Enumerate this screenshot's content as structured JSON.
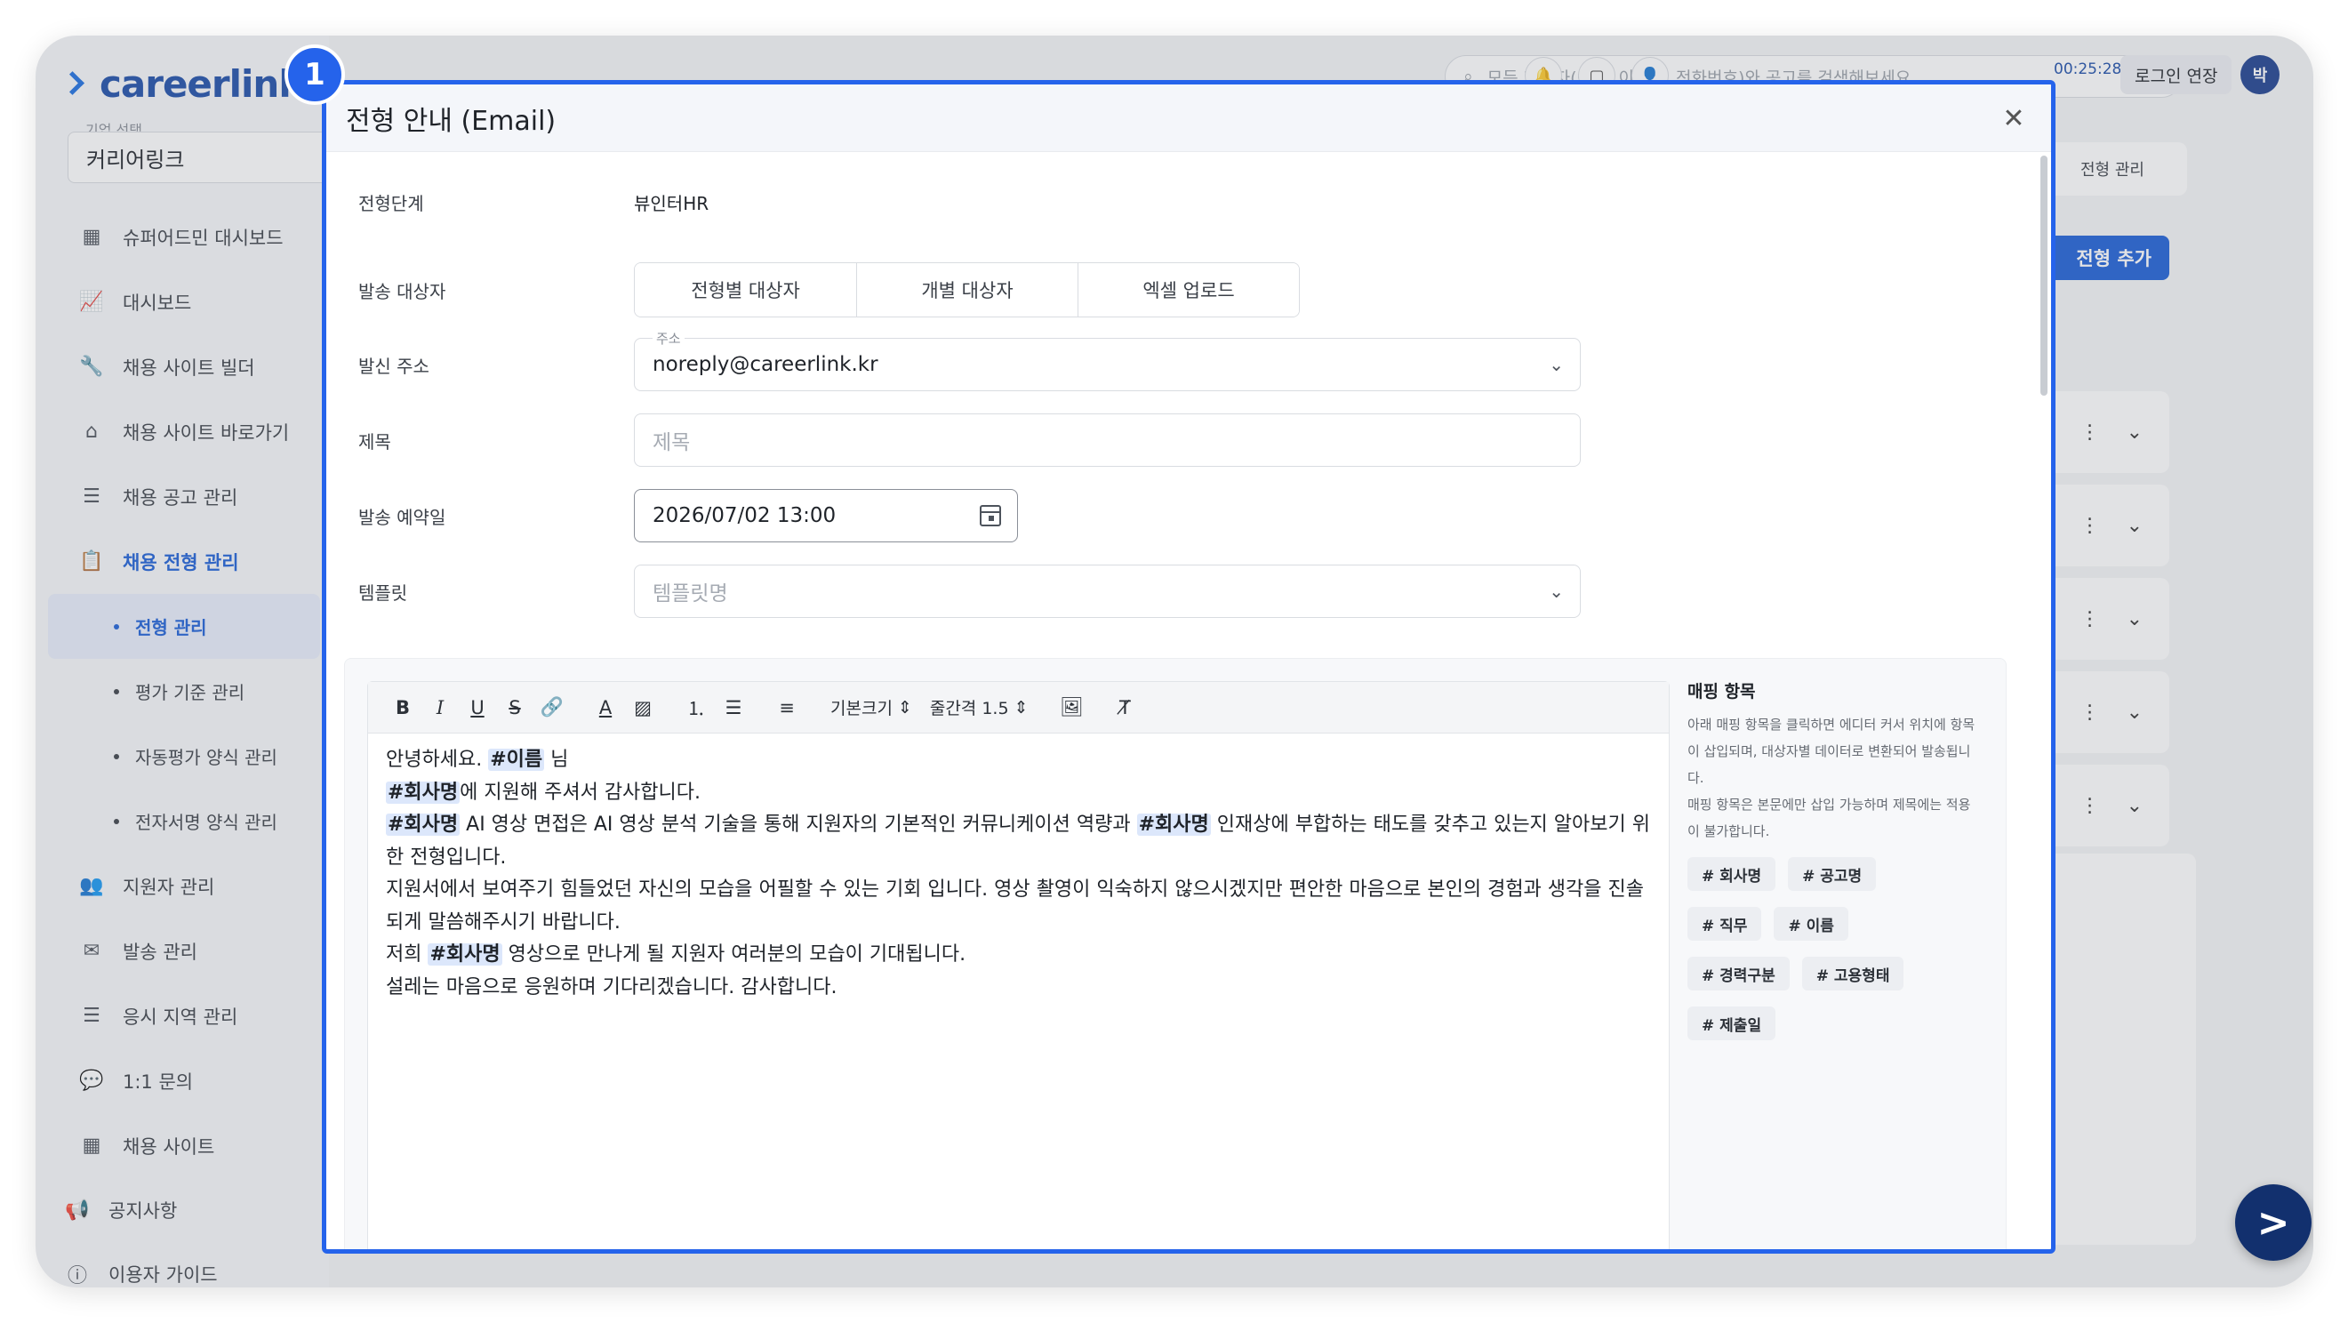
{
  "app": {
    "logo_text": "careerlink",
    "company_label": "기업 선택",
    "company_value": "커리어링크",
    "search_placeholder": "모든 지원자(이름, 이메일, 전화번호)와 공고를 검색해보세요",
    "timer": "00:25:28",
    "extend_login": "로그인 연장",
    "avatar_initial": "박",
    "breadcrumb_tail": "전형 관리",
    "add_stage_label": "전형 추가",
    "step_badge": "1"
  },
  "sidebar": {
    "items": [
      {
        "label": "슈퍼어드민 대시보드",
        "icon": "calendar-icon"
      },
      {
        "label": "대시보드",
        "icon": "chart-icon"
      },
      {
        "label": "채용 사이트 빌더",
        "icon": "wrench-icon"
      },
      {
        "label": "채용 사이트 바로가기",
        "icon": "home-icon"
      },
      {
        "label": "채용 공고 관리",
        "icon": "list-icon"
      },
      {
        "label": "채용 전형 관리",
        "icon": "clipboard-icon",
        "active": true
      }
    ],
    "sub_items": [
      {
        "label": "전형 관리",
        "active": true
      },
      {
        "label": "평가 기준 관리"
      },
      {
        "label": "자동평가 양식 관리"
      },
      {
        "label": "전자서명 양식 관리"
      }
    ],
    "items2": [
      {
        "label": "지원자 관리",
        "icon": "users-icon"
      },
      {
        "label": "발송 관리",
        "icon": "mail-icon"
      },
      {
        "label": "응시 지역 관리",
        "icon": "list-icon"
      },
      {
        "label": "1:1 문의",
        "icon": "chat-icon"
      },
      {
        "label": "채용 사이트",
        "icon": "calendar-icon"
      }
    ],
    "footer": [
      {
        "label": "공지사항",
        "icon": "megaphone-icon"
      },
      {
        "label": "이용자 가이드",
        "icon": "help-icon"
      }
    ]
  },
  "modal": {
    "title": "전형 안내 (Email)",
    "stage_label": "전형단계",
    "stage_value": "뷰인터HR",
    "recipients_label": "발송 대상자",
    "recipient_tabs": [
      "전형별 대상자",
      "개별 대상자",
      "엑셀 업로드"
    ],
    "sender_label": "발신 주소",
    "sender_float": "주소",
    "sender_value": "noreply@careerlink.kr",
    "subject_label": "제목",
    "subject_placeholder": "제목",
    "schedule_label": "발송 예약일",
    "schedule_value": "2026/07/02 13:00",
    "template_label": "템플릿",
    "template_placeholder": "템플릿명"
  },
  "editor": {
    "font_size_label": "기본크기",
    "line_height_label": "줄간격 1.5",
    "lines": [
      [
        {
          "t": "안녕하세요. "
        },
        {
          "t": "#이름",
          "tag": true
        },
        {
          "t": " 님"
        }
      ],
      [
        {
          "t": "#회사명",
          "tag": true
        },
        {
          "t": "에 지원해 주셔서 감사합니다."
        }
      ],
      [
        {
          "t": "#회사명",
          "tag": true
        },
        {
          "t": " AI 영상 면접은 AI 영상 분석 기술을 통해 지원자의 기본적인 커뮤니케이션 역량과 "
        },
        {
          "t": "#회사명",
          "tag": true
        },
        {
          "t": " 인재상에 부합하는 태도를 갖추고 있는지 알아보기 위한 전형입니다."
        }
      ],
      [
        {
          "t": "지원서에서 보여주기 힘들었던 자신의 모습을 어필할 수 있는 기회 입니다. 영상 촬영이 익숙하지 않으시겠지만 편안한 마음으로 본인의 경험과 생각을 진솔되게 말씀해주시기 바랍니다."
        }
      ],
      [
        {
          "t": "저희 "
        },
        {
          "t": "#회사명",
          "tag": true
        },
        {
          "t": " 영상으로 만나게 될 지원자 여러분의 모습이 기대됩니다."
        }
      ],
      [
        {
          "t": "설레는 마음으로 응원하며 기다리겠습니다. 감사합니다."
        }
      ]
    ]
  },
  "mapping": {
    "title": "매핑 항목",
    "desc1": "아래 매핑 항목을 클릭하면 에디터 커서 위치에 항목이 삽입되며, 대상자별 데이터로 변환되어 발송됩니다.",
    "desc2": "매핑 항목은 본문에만 삽입 가능하며 제목에는 적용이 불가합니다.",
    "chips": [
      "# 회사명",
      "# 공고명",
      "# 직무",
      "# 이름",
      "# 경력구분",
      "# 고용형태",
      "# 제출일"
    ]
  }
}
